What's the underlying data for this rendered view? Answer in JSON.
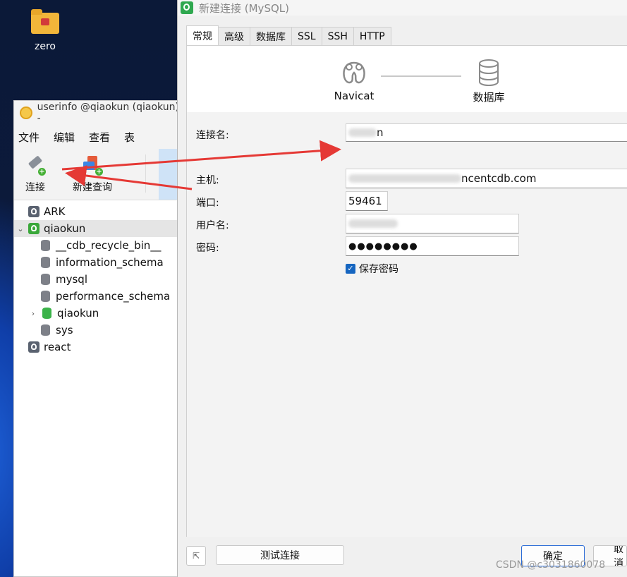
{
  "desktop": {
    "icon_label": "zero"
  },
  "main_window": {
    "title": "userinfo @qiaokun (qiaokun) -",
    "menu": [
      "文件",
      "编辑",
      "查看",
      "表"
    ],
    "toolbar": {
      "connect_label": "连接",
      "new_query_label": "新建查询"
    },
    "tree": {
      "connections": [
        "ARK",
        "qiaokun",
        "react"
      ],
      "databases": [
        "__cdb_recycle_bin__",
        "information_schema",
        "mysql",
        "performance_schema",
        "qiaokun",
        "sys"
      ]
    }
  },
  "dialog": {
    "title": "新建连接 (MySQL)",
    "tabs": [
      "常规",
      "高级",
      "数据库",
      "SSL",
      "SSH",
      "HTTP"
    ],
    "diagram": {
      "left_label": "Navicat",
      "right_label": "数据库"
    },
    "fields": {
      "conn_name_label": "连接名:",
      "conn_name_value_suffix": "n",
      "host_label": "主机:",
      "host_value_suffix": "ncentcdb.com",
      "port_label": "端口:",
      "port_value": "59461",
      "user_label": "用户名:",
      "password_label": "密码:",
      "password_value": "●●●●●●●●",
      "save_password_label": "保存密码"
    },
    "buttons": {
      "test": "测试连接",
      "ok": "确定",
      "cancel": "取消"
    }
  },
  "watermark": "CSDN @c3031860078",
  "colors": {
    "accent": "#1565c0",
    "arrow": "#e53935",
    "navicat_green": "#2fa84f"
  }
}
